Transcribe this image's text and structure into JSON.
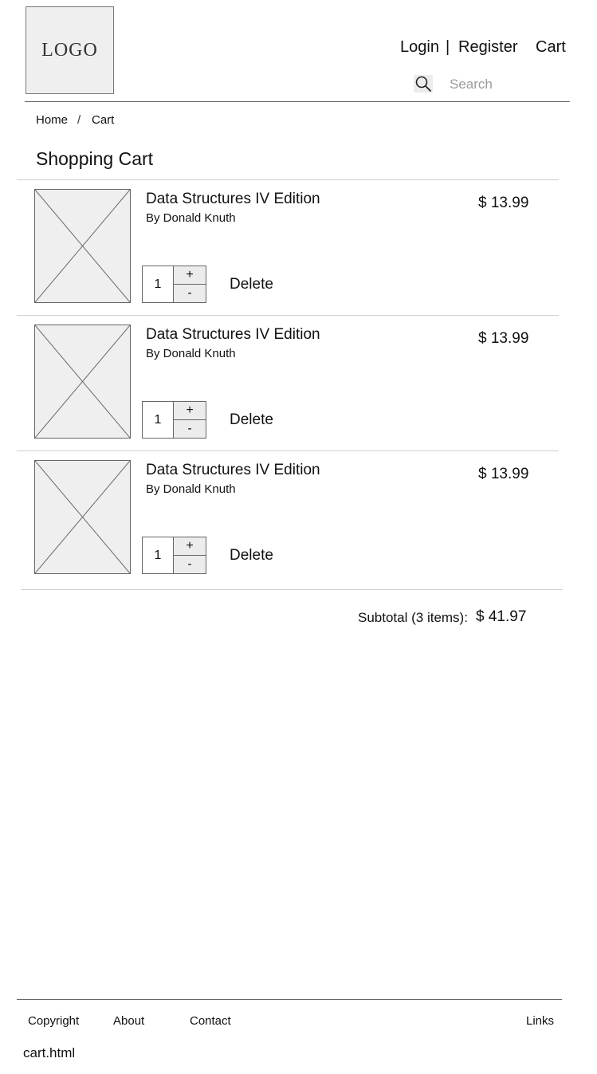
{
  "header": {
    "logo_text": "LOGO",
    "nav": {
      "login": "Login",
      "separator": "|",
      "register": "Register",
      "cart": "Cart"
    },
    "search": {
      "icon": "search-icon",
      "placeholder": "Search"
    }
  },
  "breadcrumb": {
    "home": "Home",
    "separator": "/",
    "current": "Cart"
  },
  "page_title": "Shopping Cart",
  "cart": {
    "items": [
      {
        "title": "Data Structures IV Edition",
        "author": "By Donald Knuth",
        "price": "$ 13.99",
        "quantity": "1",
        "plus_label": "+",
        "minus_label": "-",
        "delete_label": "Delete",
        "image_icon": "image-placeholder-icon"
      },
      {
        "title": "Data Structures IV Edition",
        "author": "By Donald Knuth",
        "price": "$ 13.99",
        "quantity": "1",
        "plus_label": "+",
        "minus_label": "-",
        "delete_label": "Delete",
        "image_icon": "image-placeholder-icon"
      },
      {
        "title": "Data Structures IV Edition",
        "author": "By Donald Knuth",
        "price": "$ 13.99",
        "quantity": "1",
        "plus_label": "+",
        "minus_label": "-",
        "delete_label": "Delete",
        "image_icon": "image-placeholder-icon"
      }
    ],
    "subtotal_label": "Subtotal (3 items):",
    "subtotal_value": "$ 41.97"
  },
  "footer": {
    "copyright": "Copyright",
    "about": "About",
    "contact": "Contact",
    "links": "Links"
  },
  "filename": "cart.html"
}
